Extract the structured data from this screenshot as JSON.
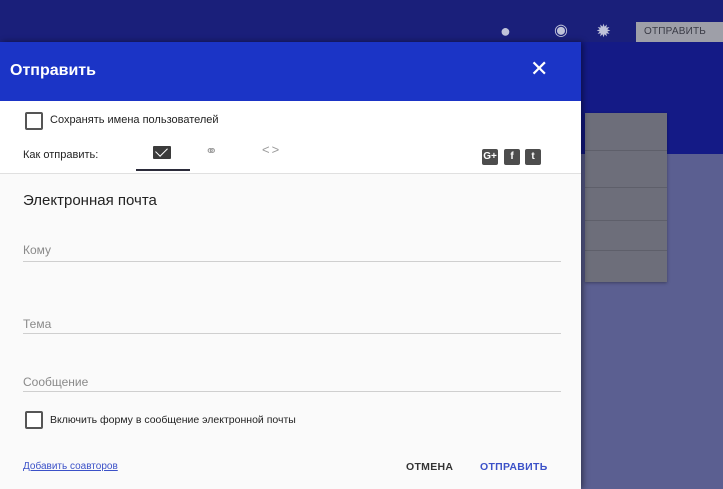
{
  "topbar": {
    "icons": [
      "palette-icon",
      "eye-icon",
      "gear-icon"
    ],
    "send_label": "ОТПРАВИТЬ"
  },
  "dialog": {
    "title": "Отправить",
    "close_icon": "close-icon",
    "collect_emails_label": "Сохранять имена пользователей",
    "how_to_send_label": "Как отправить:",
    "tabs": [
      "email-icon",
      "link-icon",
      "embed-icon"
    ],
    "social_icons": [
      "google-plus-icon",
      "facebook-icon",
      "twitter-icon"
    ],
    "social_glyphs": [
      "G+",
      "f",
      "t"
    ],
    "section_title": "Электронная почта",
    "fields": {
      "to_label": "Кому",
      "subject_label": "Тема",
      "message_label": "Сообщение"
    },
    "include_form_label": "Включить форму в сообщение электронной почты",
    "add_collaborators": "Добавить соавторов",
    "cancel_button": "ОТМЕНА",
    "send_button": "ОТПРАВИТЬ"
  },
  "colors": {
    "header": "#1b34c6",
    "accent_link": "#3b51c8",
    "app_bar": "#1a1f7a"
  }
}
